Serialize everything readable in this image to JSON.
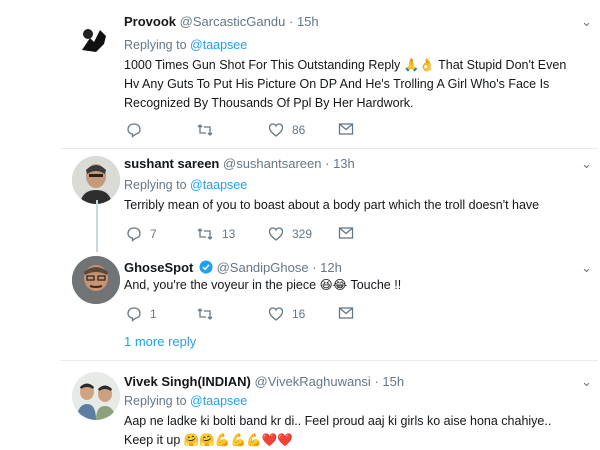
{
  "tweets": [
    {
      "name": "Provook",
      "handle": "@SarcasticGandu",
      "time": "15h",
      "replying_label": "Replying to",
      "replying_mention": "@taapsee",
      "text_lines": [
        "1000 Times Gun Shot For This Outstanding Reply 🙏👌 That Stupid Don't Even",
        "Hv Any Guts To Put His Picture On DP And He's Trolling A Girl Who's Face Is",
        "Recognized By Thousands Of Ppl By Her Hardwork."
      ],
      "reply_count": "",
      "retweet_count": "",
      "like_count": "86"
    },
    {
      "name": "sushant sareen",
      "handle": "@sushantsareen",
      "time": "13h",
      "replying_label": "Replying to",
      "replying_mention": "@taapsee",
      "text_lines": [
        "Terribly mean of you to boast about a body part which the troll doesn't have"
      ],
      "reply_count": "7",
      "retweet_count": "13",
      "like_count": "329"
    },
    {
      "name": "GhoseSpot",
      "handle": "@SandipGhose",
      "time": "12h",
      "verified": true,
      "text_lines": [
        "And, you're the voyeur in the piece 😆😂 Touche !!"
      ],
      "reply_count": "1",
      "retweet_count": "",
      "like_count": "16"
    },
    {
      "name": "Vivek Singh(INDIAN)",
      "handle": "@VivekRaghuwansi",
      "time": "15h",
      "replying_label": "Replying to",
      "replying_mention": "@taapsee",
      "text_lines": [
        "Aap ne ladke ki bolti band kr di..  Feel proud aaj ki girls ko aise hona chahiye..",
        "Keep it up 🤗🤗💪💪💪❤️❤️"
      ]
    }
  ],
  "more_replies": "1 more reply",
  "dot": "·",
  "colors": {
    "link": "#1da1f2",
    "muted": "#657786",
    "line": "#ccd6dd"
  },
  "icons": [
    "reply-icon",
    "retweet-icon",
    "like-icon",
    "dm-icon",
    "verified-icon",
    "caret-down-icon"
  ]
}
